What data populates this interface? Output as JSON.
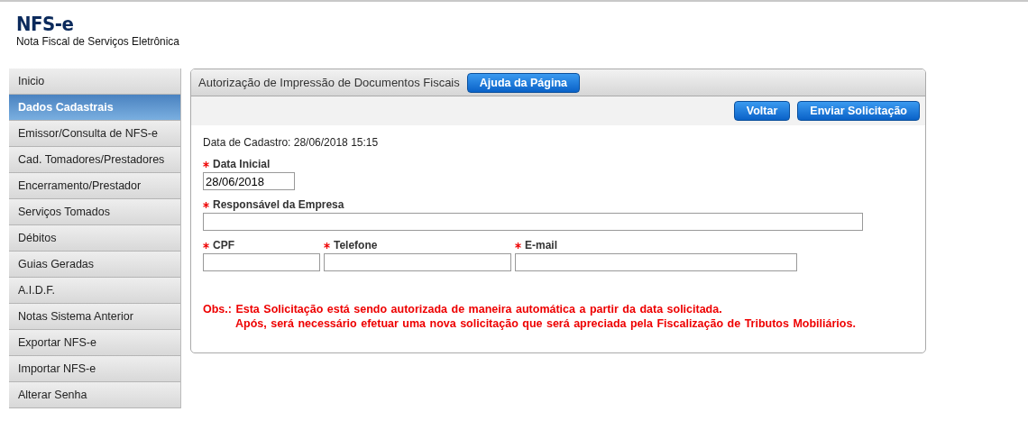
{
  "logo": {
    "title": "NFS-e",
    "subtitle": "Nota Fiscal de Serviços Eletrônica"
  },
  "sidebar": {
    "items": [
      {
        "label": "Inicio",
        "selected": false
      },
      {
        "label": "Dados Cadastrais",
        "selected": true
      },
      {
        "label": "Emissor/Consulta de NFS-e",
        "selected": false
      },
      {
        "label": "Cad. Tomadores/Prestadores",
        "selected": false
      },
      {
        "label": "Encerramento/Prestador",
        "selected": false
      },
      {
        "label": "Serviços Tomados",
        "selected": false
      },
      {
        "label": "Débitos",
        "selected": false
      },
      {
        "label": "Guias Geradas",
        "selected": false
      },
      {
        "label": "A.I.D.F.",
        "selected": false
      },
      {
        "label": "Notas Sistema Anterior",
        "selected": false
      },
      {
        "label": "Exportar NFS-e",
        "selected": false
      },
      {
        "label": "Importar NFS-e",
        "selected": false
      },
      {
        "label": "Alterar Senha",
        "selected": false
      }
    ]
  },
  "panel": {
    "title": "Autorização de Impressão de Documentos Fiscais",
    "help_button": "Ajuda da Página",
    "toolbar": [
      "Voltar",
      "Enviar Solicitação"
    ],
    "registration": {
      "label": "Data de Cadastro:",
      "value": "28/06/2018 15:15"
    },
    "form_rows": [
      [
        {
          "label": "Data Inicial",
          "required": true,
          "value": "28/06/2018"
        }
      ],
      [
        {
          "label": "Responsável da Empresa",
          "required": true
        }
      ],
      [
        {
          "label": "CPF",
          "required": true
        },
        {
          "label": "Telefone",
          "required": true
        },
        {
          "label": "E-mail",
          "required": true
        }
      ]
    ],
    "note": [
      "Obs.: Esta Solicitação está sendo autorizada de maneira automática a partir da data solicitada.",
      "Após, será necessário efetuar uma nova solicitação que será apreciada pela Fiscalização de Tributos Mobiliários."
    ]
  }
}
